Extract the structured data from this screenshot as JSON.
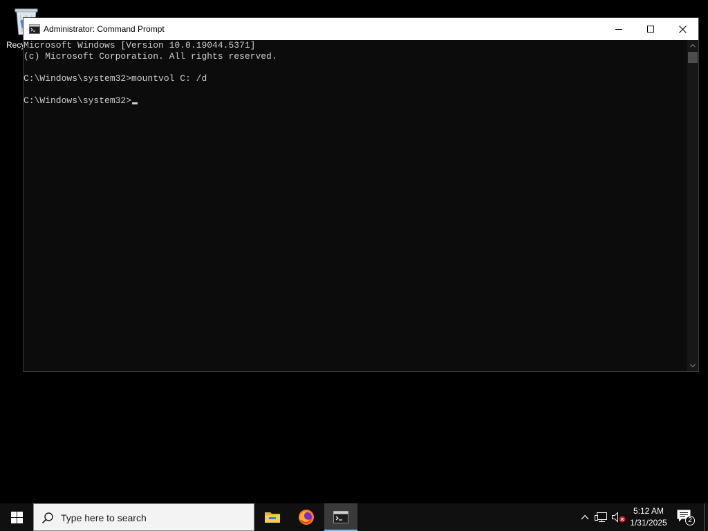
{
  "desktop": {
    "recycle_bin_label": "Recy"
  },
  "window": {
    "title": "Administrator: Command Prompt",
    "console_lines": [
      "Microsoft Windows [Version 10.0.19044.5371]",
      "(c) Microsoft Corporation. All rights reserved.",
      "C:\\Windows\\system32>mountvol C: /d",
      "C:\\Windows\\system32>"
    ],
    "colors": {
      "background": "#0c0c0c",
      "text": "#cccccc"
    }
  },
  "taskbar": {
    "search_placeholder": "Type here to search",
    "apps": [
      {
        "name": "file-explorer-icon"
      },
      {
        "name": "firefox-icon"
      },
      {
        "name": "command-prompt-icon",
        "active": true
      }
    ],
    "clock": {
      "time": "5:12 AM",
      "date": "1/31/2025"
    },
    "notification_count": "2",
    "accent": "#76b9ed"
  }
}
